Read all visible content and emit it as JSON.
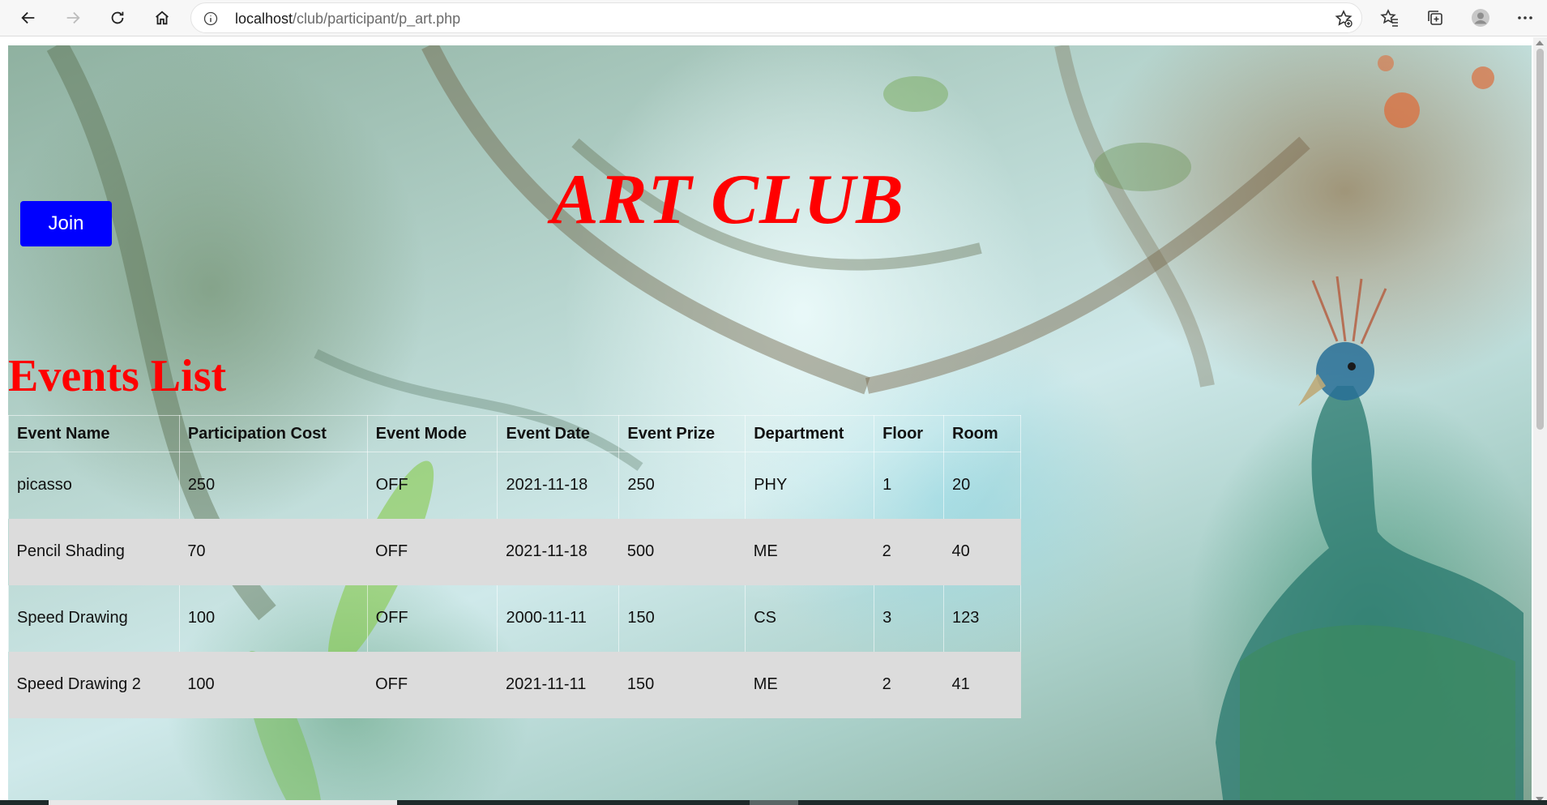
{
  "browser": {
    "url_host": "localhost",
    "url_path": "/club/participant/p_art.php"
  },
  "page": {
    "join_label": "Join",
    "title": "ART CLUB",
    "events_heading": "Events List"
  },
  "table": {
    "headers": [
      "Event Name",
      "Participation Cost",
      "Event Mode",
      "Event Date",
      "Event Prize",
      "Department",
      "Floor",
      "Room"
    ],
    "rows": [
      [
        "picasso",
        "250",
        "OFF",
        "2021-11-18",
        "250",
        "PHY",
        "1",
        "20"
      ],
      [
        "Pencil Shading",
        "70",
        "OFF",
        "2021-11-18",
        "500",
        "ME",
        "2",
        "40"
      ],
      [
        "Speed Drawing",
        "100",
        "OFF",
        "2000-11-11",
        "150",
        "CS",
        "3",
        "123"
      ],
      [
        "Speed Drawing 2",
        "100",
        "OFF",
        "2021-11-11",
        "150",
        "ME",
        "2",
        "41"
      ]
    ]
  },
  "colors": {
    "title": "#ff0000",
    "join_button": "#0000ff",
    "shaded_row": "#dcdcdc"
  },
  "icons": [
    "back-arrow-icon",
    "forward-arrow-icon",
    "refresh-icon",
    "home-icon",
    "info-icon",
    "add-favorite-icon",
    "favorites-icon",
    "collections-icon",
    "profile-icon",
    "more-icon"
  ]
}
